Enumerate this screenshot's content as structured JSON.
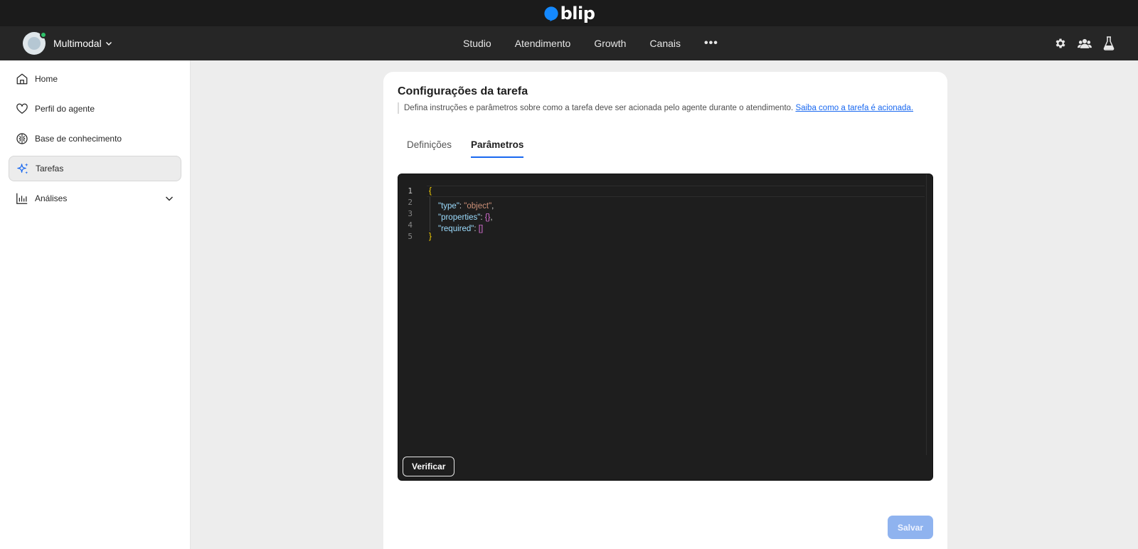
{
  "brand": {
    "name": "blip",
    "color": "#1489ff"
  },
  "account": {
    "name": "Multimodal"
  },
  "nav": {
    "links": [
      "Studio",
      "Atendimento",
      "Growth",
      "Canais"
    ],
    "more": "•••",
    "icons": [
      "gear-icon",
      "people-icon",
      "flask-icon"
    ]
  },
  "sidebar": {
    "items": [
      {
        "label": "Home",
        "icon": "home-icon"
      },
      {
        "label": "Perfil do agente",
        "icon": "heart-icon"
      },
      {
        "label": "Base de conhecimento",
        "icon": "brain-icon"
      },
      {
        "label": "Tarefas",
        "icon": "sparkle-icon",
        "active": true
      },
      {
        "label": "Análises",
        "icon": "chart-icon",
        "expandable": true
      }
    ]
  },
  "card": {
    "title": "Configurações da tarefa",
    "description": "Defina instruções e parâmetros sobre como a tarefa deve ser acionada pelo agente durante o atendimento.",
    "link": "Saiba como a tarefa é acionada.",
    "tabs": [
      {
        "label": "Definições",
        "active": false
      },
      {
        "label": "Parâmetros",
        "active": true
      }
    ]
  },
  "editor": {
    "lines": [
      "1",
      "2",
      "3",
      "4",
      "5"
    ],
    "tokens": {
      "open": "{",
      "type_key": "\"type\"",
      "type_val": "\"object\"",
      "props_key": "\"properties\"",
      "props_val": "{}",
      "req_key": "\"required\"",
      "req_val": "[]",
      "close": "}",
      "colon": ": ",
      "comma": ","
    },
    "verify_label": "Verificar"
  },
  "actions": {
    "save_label": "Salvar"
  },
  "colors": {
    "accent": "#1968f0",
    "save_disabled": "#8fb3ef",
    "editor_bg": "#1e1e1e"
  }
}
